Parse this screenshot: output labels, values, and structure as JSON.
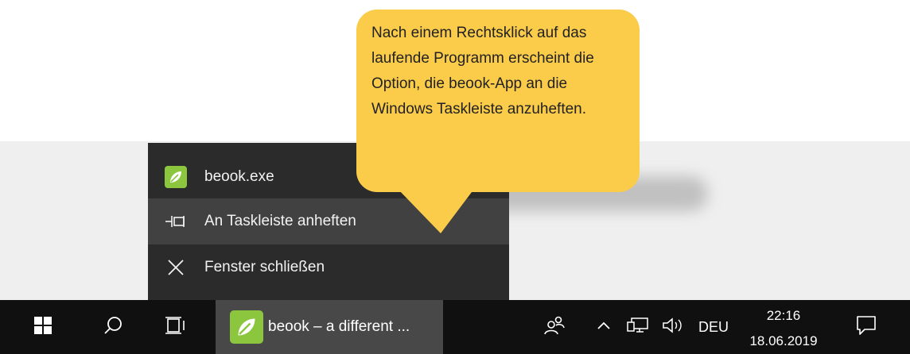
{
  "context_menu": {
    "items": [
      {
        "label": "beook.exe",
        "icon": "beook-leaf-icon"
      },
      {
        "label": "An Taskleiste anheften",
        "icon": "pin-icon"
      },
      {
        "label": "Fenster schließen",
        "icon": "close-icon"
      }
    ]
  },
  "callout": {
    "text": "Nach einem Rechtsklick auf das laufende Programm erscheint die Option, die beook-App an die Windows Taskleiste anzuheften."
  },
  "taskbar": {
    "start_icon": "windows-logo-icon",
    "search_icon": "search-icon",
    "task_view_icon": "task-view-icon",
    "running_app": {
      "label": "beook – a different ...",
      "icon": "beook-leaf-icon"
    },
    "people_icon": "people-icon",
    "tray": {
      "chevron_icon": "chevron-up-icon",
      "network_icon": "network-icon",
      "volume_icon": "volume-icon",
      "language": "DEU"
    },
    "clock": {
      "time": "22:16",
      "date": "18.06.2019"
    },
    "notification_icon": "action-center-icon"
  },
  "colors": {
    "callout": "#fbcb4a",
    "menu_background": "#2b2b2b",
    "menu_hover": "#414141",
    "taskbar": "#101010",
    "app_accent": "#8cc63f"
  }
}
